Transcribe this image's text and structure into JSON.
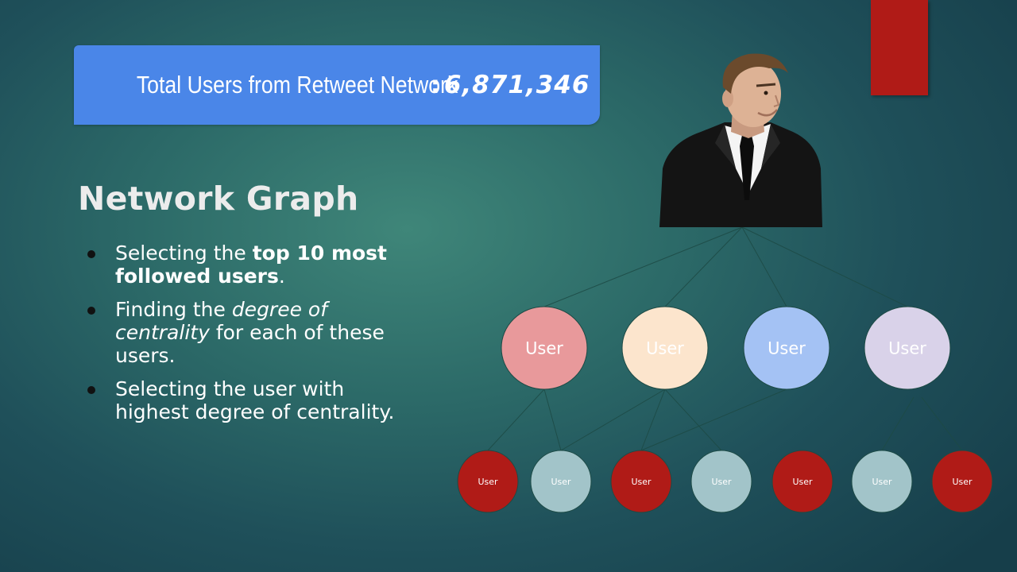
{
  "banner": {
    "label": "Total Users from Retweet Network",
    "colon": ":",
    "value": "6,871,346"
  },
  "title": "Network Graph",
  "bullets": [
    [
      {
        "t": "Selecting the ",
        "s": "normal"
      },
      {
        "t": "top 10 most followed users",
        "s": "bold"
      },
      {
        "t": ".",
        "s": "normal"
      }
    ],
    [
      {
        "t": "Finding the ",
        "s": "normal"
      },
      {
        "t": "degree of centrality",
        "s": "italic"
      },
      {
        "t": " for each of these users.",
        "s": "normal"
      }
    ],
    [
      {
        "t": "Selecting the user with highest degree of centrality.",
        "s": "normal"
      }
    ]
  ],
  "graph": {
    "top_nodes": [
      {
        "label": "User",
        "fill": "#e8999b"
      },
      {
        "label": "User",
        "fill": "#fce5cd"
      },
      {
        "label": "User",
        "fill": "#a4c2f4"
      },
      {
        "label": "User",
        "fill": "#d9d2e9"
      }
    ],
    "bottom_nodes": [
      {
        "label": "User",
        "fill": "#b01b17"
      },
      {
        "label": "User",
        "fill": "#a2c4c9"
      },
      {
        "label": "User",
        "fill": "#b01b17"
      },
      {
        "label": "User",
        "fill": "#a2c4c9"
      },
      {
        "label": "User",
        "fill": "#b01b17"
      },
      {
        "label": "User",
        "fill": "#a2c4c9"
      },
      {
        "label": "User",
        "fill": "#b01b17"
      }
    ],
    "edge_color": "#1d4a45"
  },
  "colors": {
    "accent_red": "#b01b17",
    "banner_blue": "#4a86e8"
  },
  "icons": [
    "person-photo"
  ]
}
